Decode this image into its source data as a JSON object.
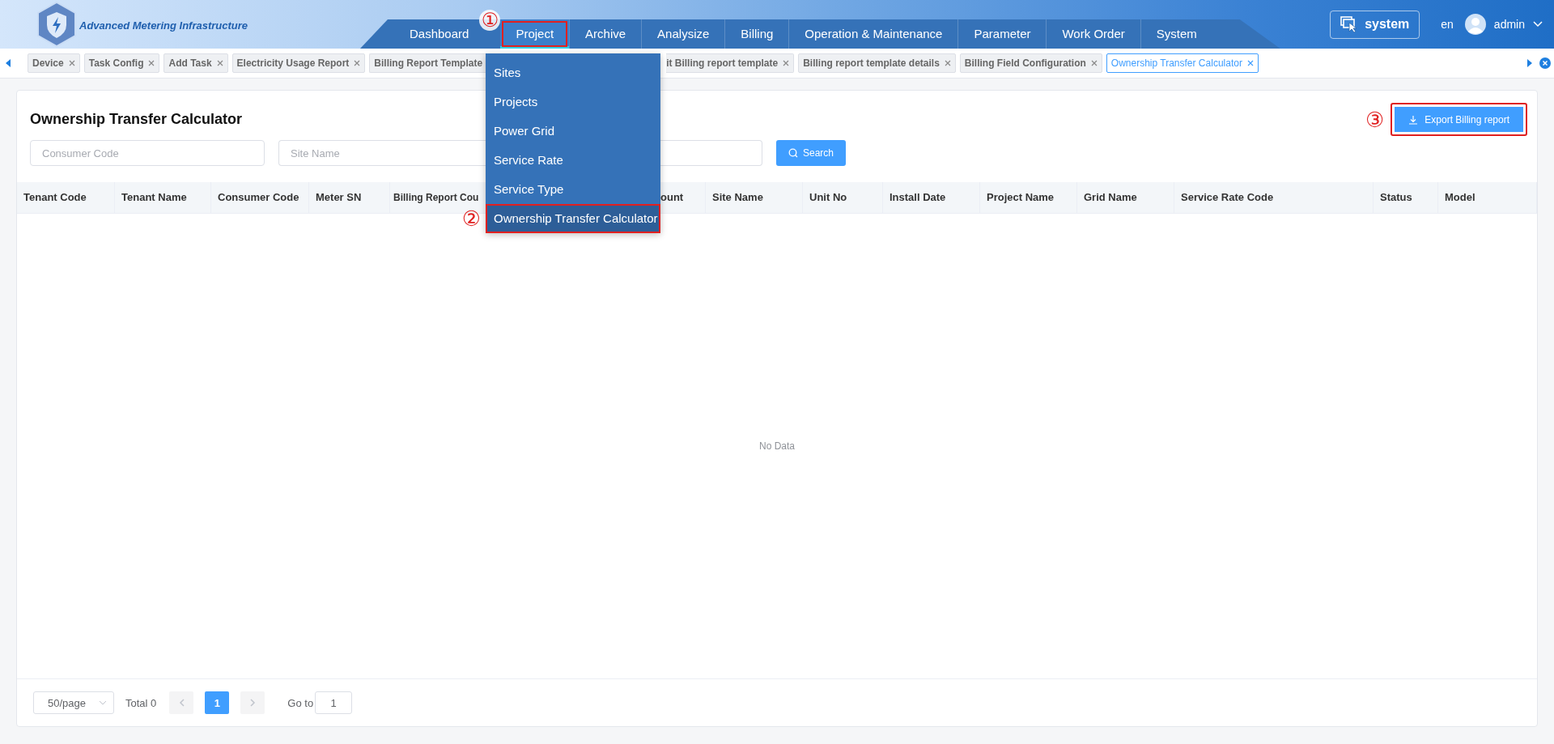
{
  "header": {
    "app_title": "Advanced Metering Infrastructure",
    "system_button": "system",
    "language": "en",
    "user": "admin",
    "nav": [
      {
        "label": "Dashboard",
        "selected": false,
        "highlighted": false
      },
      {
        "label": "Project",
        "selected": true,
        "highlighted": true,
        "marker": "①"
      },
      {
        "label": "Archive",
        "selected": false,
        "highlighted": false
      },
      {
        "label": "Analysize",
        "selected": false,
        "highlighted": false
      },
      {
        "label": "Billing",
        "selected": false,
        "highlighted": false
      },
      {
        "label": "Operation & Maintenance",
        "selected": false,
        "highlighted": false
      },
      {
        "label": "Parameter",
        "selected": false,
        "highlighted": false
      },
      {
        "label": "Work Order",
        "selected": false,
        "highlighted": false
      },
      {
        "label": "System",
        "selected": false,
        "highlighted": false
      }
    ]
  },
  "dropdown": {
    "items": [
      {
        "label": "Sites",
        "selected": false,
        "highlighted": false
      },
      {
        "label": "Projects",
        "selected": false,
        "highlighted": false
      },
      {
        "label": "Power Grid",
        "selected": false,
        "highlighted": false
      },
      {
        "label": "Service Rate",
        "selected": false,
        "highlighted": false
      },
      {
        "label": "Service Type",
        "selected": false,
        "highlighted": false
      },
      {
        "label": "Ownership Transfer Calculator",
        "selected": true,
        "highlighted": true,
        "marker": "②"
      }
    ]
  },
  "tabs": [
    {
      "label": "Device",
      "selected": false,
      "clipped_left": false
    },
    {
      "label": "Task Config",
      "selected": false,
      "clipped_left": false
    },
    {
      "label": "Add Task",
      "selected": false,
      "clipped_left": false
    },
    {
      "label": "Electricity Usage Report",
      "selected": false,
      "clipped_left": false
    },
    {
      "label": "Billing Report Template",
      "selected": false,
      "clipped_left": false,
      "clipped_right": true
    },
    {
      "label": "it Billing report template",
      "selected": false,
      "clipped_left": true
    },
    {
      "label": "Billing report template details",
      "selected": false,
      "clipped_left": false
    },
    {
      "label": "Billing Field Configuration",
      "selected": false,
      "clipped_left": false
    },
    {
      "label": "Ownership Transfer Calculator",
      "selected": true,
      "clipped_left": false
    }
  ],
  "page": {
    "title": "Ownership Transfer Calculator",
    "export_button": {
      "label": "Export Billing report",
      "highlighted": true,
      "marker": "③"
    },
    "filters": [
      {
        "kind": "input",
        "placeholder": "Consumer Code"
      },
      {
        "kind": "input",
        "placeholder": "Site Name"
      },
      {
        "kind": "input"
      }
    ],
    "search_button": "Search",
    "table": {
      "columns": [
        "Tenant Code",
        "Tenant Name",
        "Consumer Code",
        "Meter SN",
        "Billing Report Cou",
        "ount",
        "Site Name",
        "Unit No",
        "Install Date",
        "Project Name",
        "Grid Name",
        "Service Rate Code",
        "Status",
        "Model"
      ],
      "empty_text": "No Data"
    },
    "pagination": {
      "page_size": "50/page",
      "total": "Total 0",
      "pages": [
        {
          "label": "1",
          "selected": true
        }
      ],
      "goto_label": "Go to",
      "goto_value": "1"
    }
  }
}
